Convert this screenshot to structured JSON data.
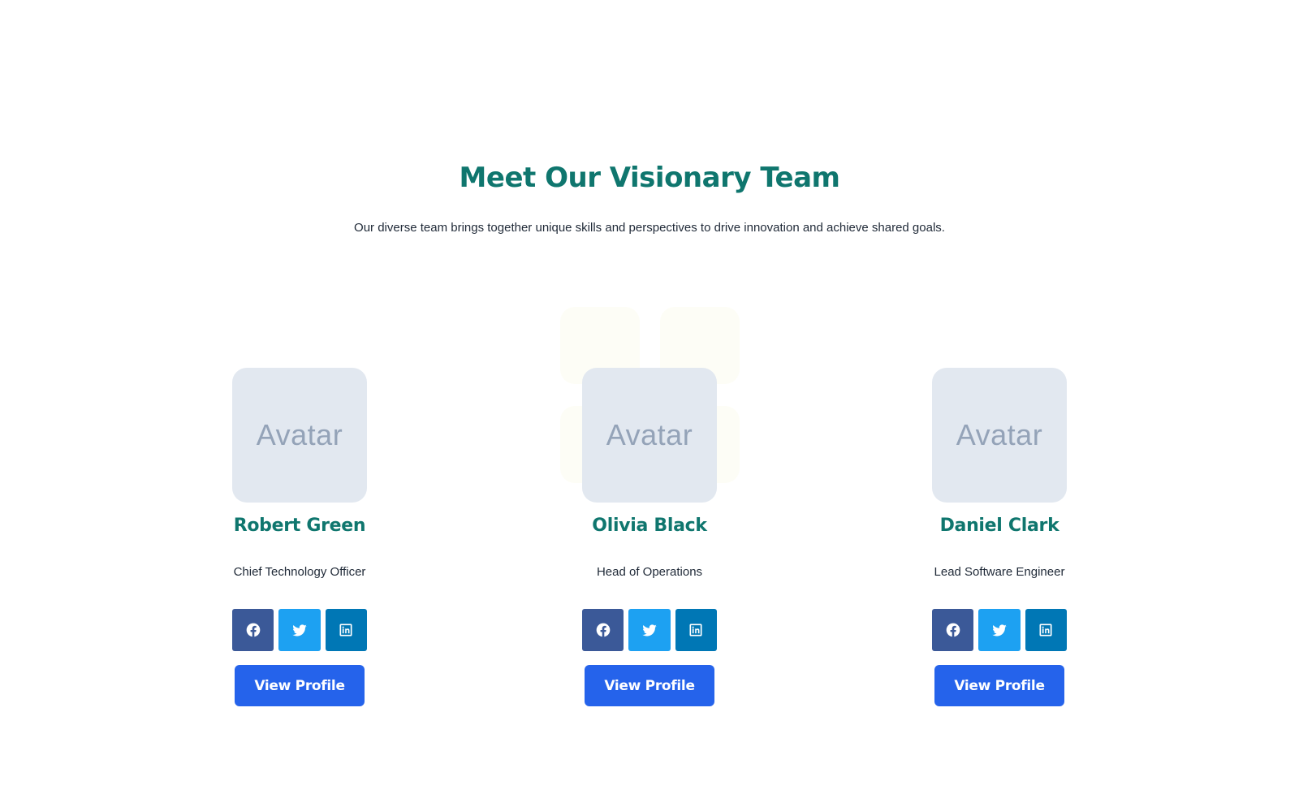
{
  "section": {
    "title": "Meet Our Visionary Team",
    "subtitle": "Our diverse team brings together unique skills and perspectives to drive innovation and achieve shared goals."
  },
  "colors": {
    "heading": "#0f766e",
    "primary_button": "#2563eb",
    "facebook": "#3b5998",
    "twitter": "#1da1f2",
    "linkedin": "#0077b5",
    "avatar_bg": "#e2e8f0"
  },
  "team": [
    {
      "avatar_text": "Avatar",
      "name": "Robert Green",
      "role": "Chief Technology Officer",
      "socials": [
        "facebook-icon",
        "twitter-icon",
        "linkedin-icon"
      ],
      "button_label": "View Profile"
    },
    {
      "avatar_text": "Avatar",
      "name": "Olivia Black",
      "role": "Head of Operations",
      "socials": [
        "facebook-icon",
        "twitter-icon",
        "linkedin-icon"
      ],
      "button_label": "View Profile"
    },
    {
      "avatar_text": "Avatar",
      "name": "Daniel Clark",
      "role": "Lead Software Engineer",
      "socials": [
        "facebook-icon",
        "twitter-icon",
        "linkedin-icon"
      ],
      "button_label": "View Profile"
    }
  ]
}
